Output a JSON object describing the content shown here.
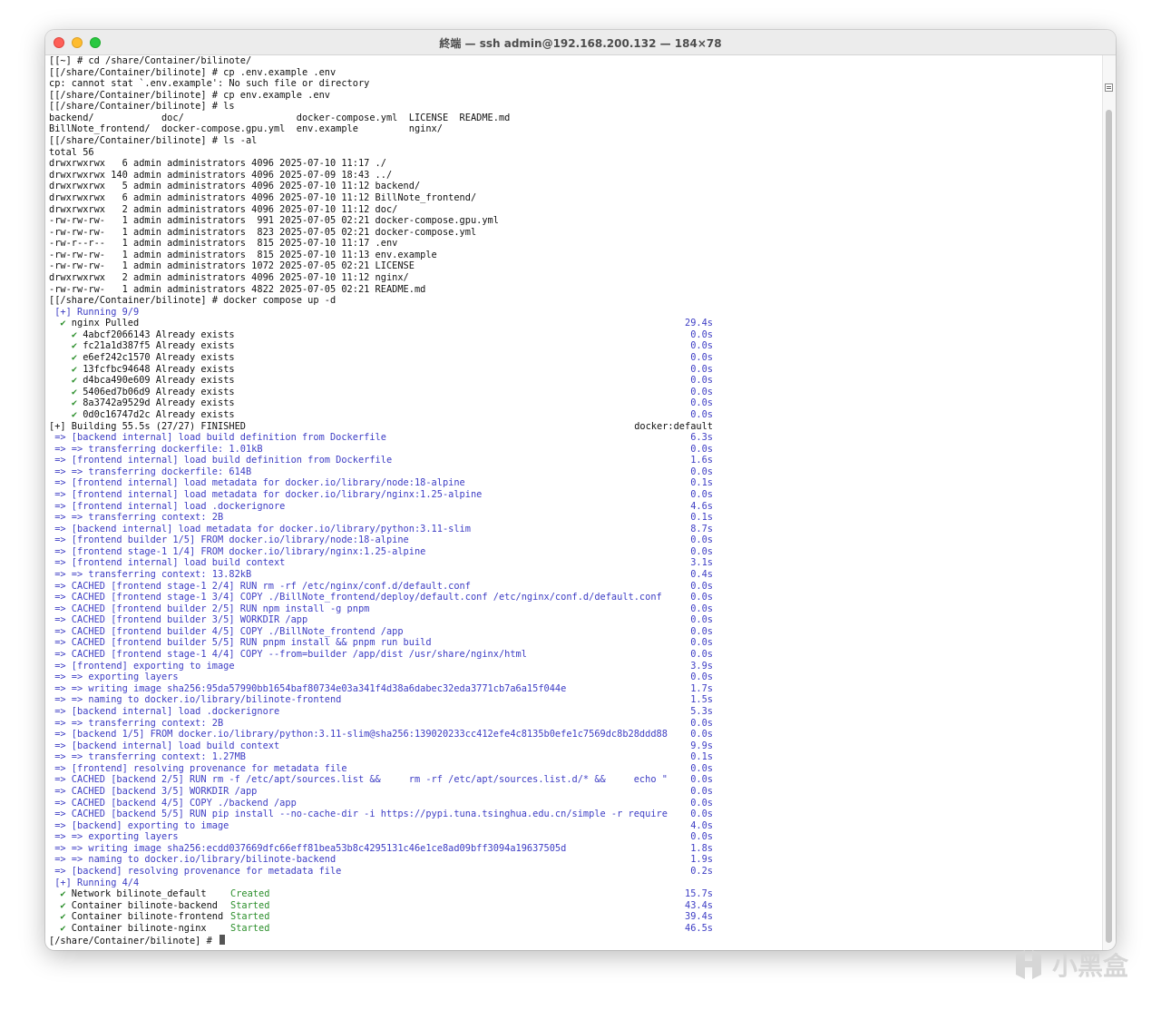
{
  "window": {
    "title": "終端 — ssh admin@192.168.200.132 — 184×78"
  },
  "terminal": {
    "lines": [
      {
        "text": "[[~] # cd /share/Container/bilinote/"
      },
      {
        "text": "[[/share/Container/bilinote] # cp .env.example .env"
      },
      {
        "text": "cp: cannot stat `.env.example': No such file or directory"
      },
      {
        "text": "[[/share/Container/bilinote] # cp env.example .env"
      },
      {
        "text": "[[/share/Container/bilinote] # ls"
      },
      {
        "text": "backend/            doc/                    docker-compose.yml  LICENSE  README.md"
      },
      {
        "text": "BillNote_frontend/  docker-compose.gpu.yml  env.example         nginx/"
      },
      {
        "text": "[[/share/Container/bilinote] # ls -al"
      },
      {
        "text": "total 56"
      },
      {
        "text": "drwxrwxrwx   6 admin administrators 4096 2025-07-10 11:17 ./"
      },
      {
        "text": "drwxrwxrwx 140 admin administrators 4096 2025-07-09 18:43 ../"
      },
      {
        "text": "drwxrwxrwx   5 admin administrators 4096 2025-07-10 11:12 backend/"
      },
      {
        "text": "drwxrwxrwx   6 admin administrators 4096 2025-07-10 11:12 BillNote_frontend/"
      },
      {
        "text": "drwxrwxrwx   2 admin administrators 4096 2025-07-10 11:12 doc/"
      },
      {
        "text": "-rw-rw-rw-   1 admin administrators  991 2025-07-05 02:21 docker-compose.gpu.yml"
      },
      {
        "text": "-rw-rw-rw-   1 admin administrators  823 2025-07-05 02:21 docker-compose.yml"
      },
      {
        "text": "-rw-r--r--   1 admin administrators  815 2025-07-10 11:17 .env"
      },
      {
        "text": "-rw-rw-rw-   1 admin administrators  815 2025-07-10 11:13 env.example"
      },
      {
        "text": "-rw-rw-rw-   1 admin administrators 1072 2025-07-05 02:21 LICENSE"
      },
      {
        "text": "drwxrwxrwx   2 admin administrators 4096 2025-07-10 11:12 nginx/"
      },
      {
        "text": "-rw-rw-rw-   1 admin administrators 4822 2025-07-05 02:21 README.md"
      },
      {
        "text": "[[/share/Container/bilinote] # docker compose up -d"
      },
      {
        "text": " [+] Running 9/9",
        "color": "blue"
      },
      {
        "text": "  ✔ nginx Pulled",
        "right": "29.4s"
      },
      {
        "text": "    ✔ 4abcf2066143 Already exists",
        "right": "0.0s"
      },
      {
        "text": "    ✔ fc21a1d387f5 Already exists",
        "right": "0.0s"
      },
      {
        "text": "    ✔ e6ef242c1570 Already exists",
        "right": "0.0s"
      },
      {
        "text": "    ✔ 13fcfbc94648 Already exists",
        "right": "0.0s"
      },
      {
        "text": "    ✔ d4bca490e609 Already exists",
        "right": "0.0s"
      },
      {
        "text": "    ✔ 5406ed7b06d9 Already exists",
        "right": "0.0s"
      },
      {
        "text": "    ✔ 8a3742a9529d Already exists",
        "right": "0.0s"
      },
      {
        "text": "    ✔ 0d0c16747d2c Already exists",
        "right": "0.0s"
      },
      {
        "text": "[+] Building 55.5s (27/27) FINISHED",
        "right": "docker:default",
        "rightColor": "plain"
      },
      {
        "text": " => [backend internal] load build definition from Dockerfile",
        "right": "6.3s",
        "color": "blue"
      },
      {
        "text": " => => transferring dockerfile: 1.01kB",
        "right": "0.0s",
        "color": "blue"
      },
      {
        "text": " => [frontend internal] load build definition from Dockerfile",
        "right": "1.6s",
        "color": "blue"
      },
      {
        "text": " => => transferring dockerfile: 614B",
        "right": "0.0s",
        "color": "blue"
      },
      {
        "text": " => [frontend internal] load metadata for docker.io/library/node:18-alpine",
        "right": "0.1s",
        "color": "blue"
      },
      {
        "text": " => [frontend internal] load metadata for docker.io/library/nginx:1.25-alpine",
        "right": "0.0s",
        "color": "blue"
      },
      {
        "text": " => [frontend internal] load .dockerignore",
        "right": "4.6s",
        "color": "blue"
      },
      {
        "text": " => => transferring context: 2B",
        "right": "0.1s",
        "color": "blue"
      },
      {
        "text": " => [backend internal] load metadata for docker.io/library/python:3.11-slim",
        "right": "8.7s",
        "color": "blue"
      },
      {
        "text": " => [frontend builder 1/5] FROM docker.io/library/node:18-alpine",
        "right": "0.0s",
        "color": "blue"
      },
      {
        "text": " => [frontend stage-1 1/4] FROM docker.io/library/nginx:1.25-alpine",
        "right": "0.0s",
        "color": "blue"
      },
      {
        "text": " => [frontend internal] load build context",
        "right": "3.1s",
        "color": "blue"
      },
      {
        "text": " => => transferring context: 13.82kB",
        "right": "0.4s",
        "color": "blue"
      },
      {
        "text": " => CACHED [frontend stage-1 2/4] RUN rm -rf /etc/nginx/conf.d/default.conf",
        "right": "0.0s",
        "color": "blue"
      },
      {
        "text": " => CACHED [frontend stage-1 3/4] COPY ./BillNote_frontend/deploy/default.conf /etc/nginx/conf.d/default.conf",
        "right": "0.0s",
        "color": "blue"
      },
      {
        "text": " => CACHED [frontend builder 2/5] RUN npm install -g pnpm",
        "right": "0.0s",
        "color": "blue"
      },
      {
        "text": " => CACHED [frontend builder 3/5] WORKDIR /app",
        "right": "0.0s",
        "color": "blue"
      },
      {
        "text": " => CACHED [frontend builder 4/5] COPY ./BillNote_frontend /app",
        "right": "0.0s",
        "color": "blue"
      },
      {
        "text": " => CACHED [frontend builder 5/5] RUN pnpm install && pnpm run build",
        "right": "0.0s",
        "color": "blue"
      },
      {
        "text": " => CACHED [frontend stage-1 4/4] COPY --from=builder /app/dist /usr/share/nginx/html",
        "right": "0.0s",
        "color": "blue"
      },
      {
        "text": " => [frontend] exporting to image",
        "right": "3.9s",
        "color": "blue"
      },
      {
        "text": " => => exporting layers",
        "right": "0.0s",
        "color": "blue"
      },
      {
        "text": " => => writing image sha256:95da57990bb1654baf80734e03a341f4d38a6dabec32eda3771cb7a6a15f044e",
        "right": "1.7s",
        "color": "blue"
      },
      {
        "text": " => => naming to docker.io/library/bilinote-frontend",
        "right": "1.5s",
        "color": "blue"
      },
      {
        "text": " => [backend internal] load .dockerignore",
        "right": "5.3s",
        "color": "blue"
      },
      {
        "text": " => => transferring context: 2B",
        "right": "0.0s",
        "color": "blue"
      },
      {
        "text": " => [backend 1/5] FROM docker.io/library/python:3.11-slim@sha256:139020233cc412efe4c8135b0efe1c7569dc8b28ddd88",
        "right": "0.0s",
        "color": "blue"
      },
      {
        "text": " => [backend internal] load build context",
        "right": "9.9s",
        "color": "blue"
      },
      {
        "text": " => => transferring context: 1.27MB",
        "right": "0.1s",
        "color": "blue"
      },
      {
        "text": " => [frontend] resolving provenance for metadata file",
        "right": "0.0s",
        "color": "blue"
      },
      {
        "text": " => CACHED [backend 2/5] RUN rm -f /etc/apt/sources.list &&     rm -rf /etc/apt/sources.list.d/* &&     echo \"",
        "right": "0.0s",
        "color": "blue"
      },
      {
        "text": " => CACHED [backend 3/5] WORKDIR /app",
        "right": "0.0s",
        "color": "blue"
      },
      {
        "text": " => CACHED [backend 4/5] COPY ./backend /app",
        "right": "0.0s",
        "color": "blue"
      },
      {
        "text": " => CACHED [backend 5/5] RUN pip install --no-cache-dir -i https://pypi.tuna.tsinghua.edu.cn/simple -r require",
        "right": "0.0s",
        "color": "blue"
      },
      {
        "text": " => [backend] exporting to image",
        "right": "4.0s",
        "color": "blue"
      },
      {
        "text": " => => exporting layers",
        "right": "0.0s",
        "color": "blue"
      },
      {
        "text": " => => writing image sha256:ecdd037669dfc66eff81bea53b8c4295131c46e1ce8ad09bff3094a19637505d",
        "right": "1.8s",
        "color": "blue"
      },
      {
        "text": " => => naming to docker.io/library/bilinote-backend",
        "right": "1.9s",
        "color": "blue"
      },
      {
        "text": " => [backend] resolving provenance for metadata file",
        "right": "0.2s",
        "color": "blue"
      },
      {
        "text": " [+] Running 4/4",
        "color": "blue"
      },
      {
        "text": "  ✔ Network bilinote_default",
        "status": "Created",
        "right": "15.7s"
      },
      {
        "text": "  ✔ Container bilinote-backend",
        "status": "Started",
        "right": "43.4s"
      },
      {
        "text": "  ✔ Container bilinote-frontend",
        "status": "Started",
        "right": "39.4s"
      },
      {
        "text": "  ✔ Container bilinote-nginx",
        "status": "Started",
        "right": "46.5s"
      },
      {
        "text": "[/share/Container/bilinote] # ",
        "cursor": true
      }
    ]
  },
  "watermark": {
    "text": "小黑盒"
  },
  "colors": {
    "blue": "#3d3dc4",
    "green": "#2c8f2c"
  }
}
